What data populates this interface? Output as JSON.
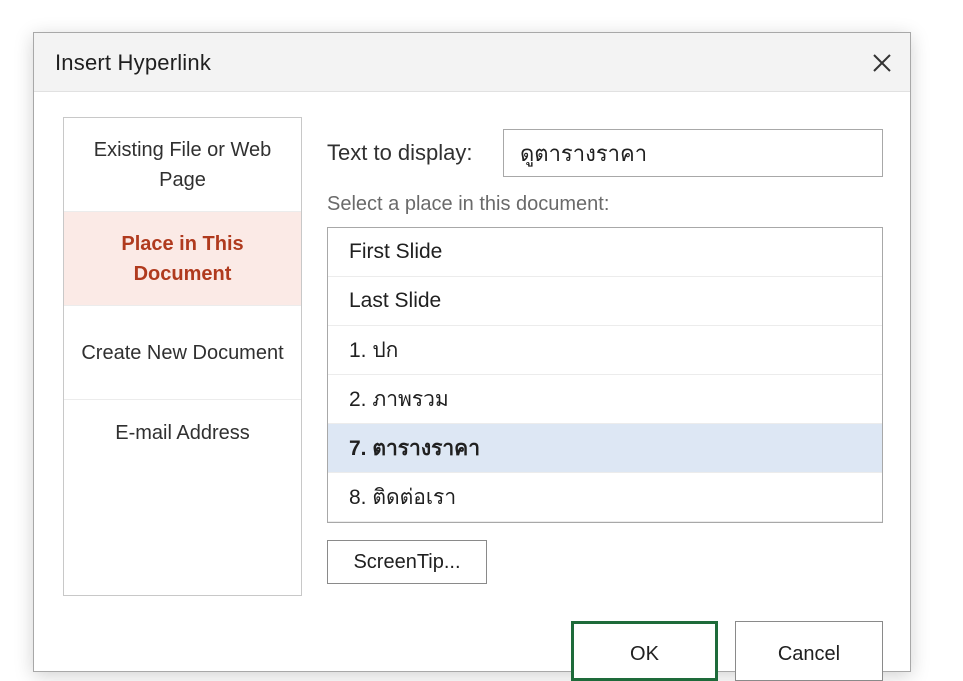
{
  "dialog": {
    "title": "Insert Hyperlink",
    "close_icon": "close-icon"
  },
  "link_to": {
    "items": [
      {
        "label": "Existing File or Web Page",
        "selected": false
      },
      {
        "label": "Place in This Document",
        "selected": true
      },
      {
        "label": "Create New Document",
        "selected": false
      },
      {
        "label": "E-mail Address",
        "selected": false
      }
    ]
  },
  "text_to_display": {
    "label": "Text to display:",
    "value": "ดูตารางราคา"
  },
  "place": {
    "label": "Select a place in this document:",
    "items": [
      {
        "label": "First Slide",
        "selected": false
      },
      {
        "label": "Last Slide",
        "selected": false
      },
      {
        "label": "1. ปก",
        "selected": false
      },
      {
        "label": "2. ภาพรวม",
        "selected": false
      },
      {
        "label": "7. ตารางราคา",
        "selected": true
      },
      {
        "label": "8. ติดต่อเรา",
        "selected": false
      }
    ]
  },
  "buttons": {
    "screentip": "ScreenTip...",
    "ok": "OK",
    "cancel": "Cancel"
  },
  "colors": {
    "accent_selected_text": "#b03a1e",
    "accent_selected_bg": "#fbeae6",
    "list_selected_bg": "#dde7f4",
    "ok_border": "#1e6b3a"
  }
}
